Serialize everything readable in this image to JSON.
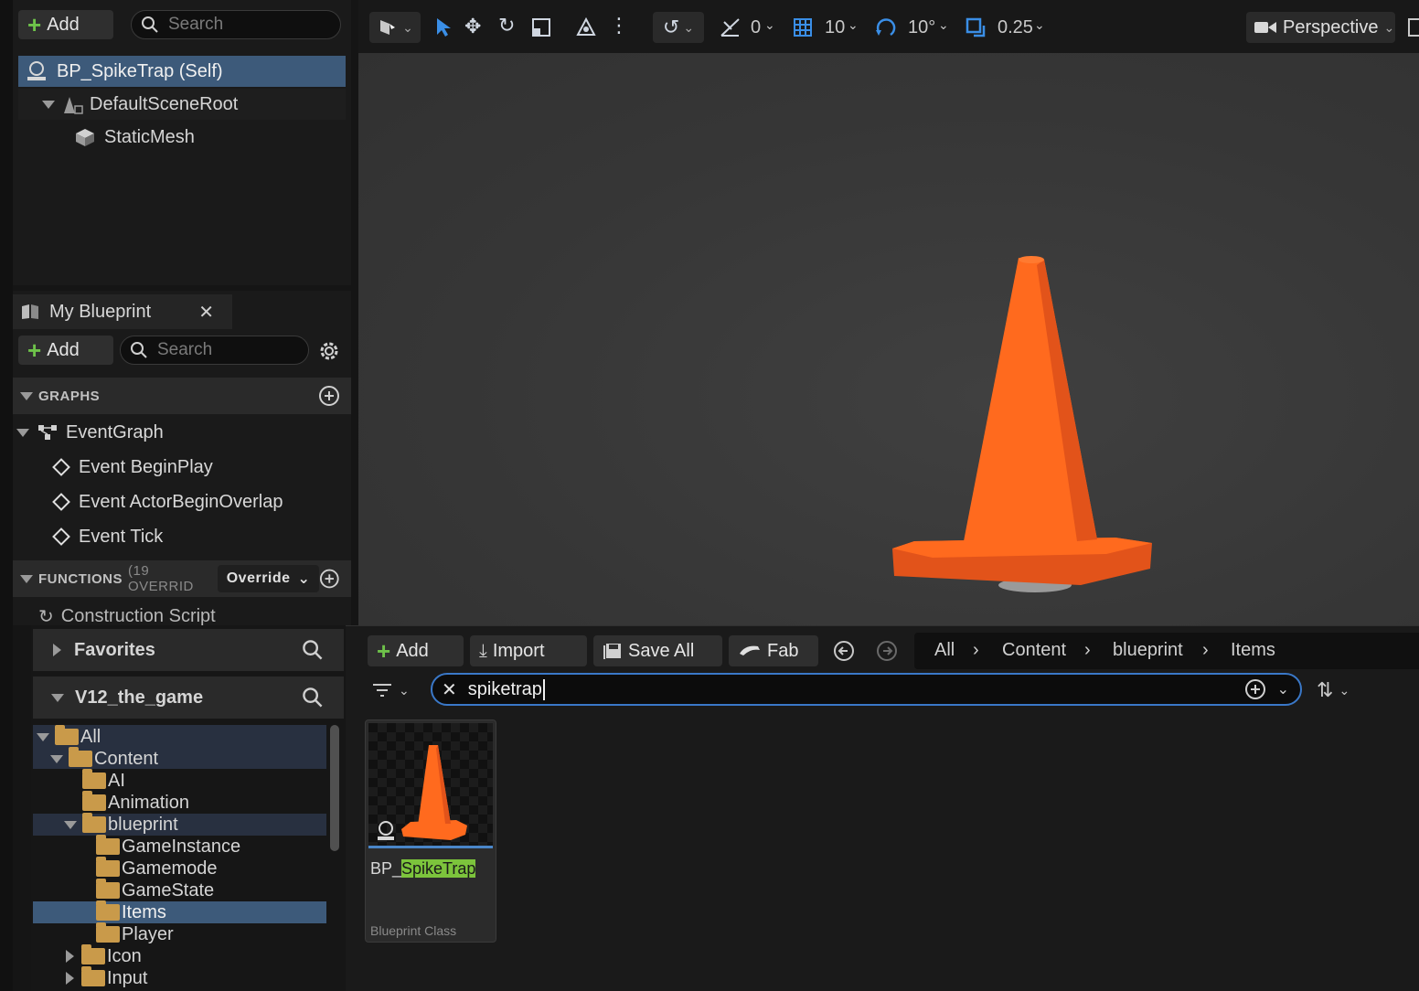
{
  "components": {
    "add_label": "Add",
    "search_placeholder": "Search",
    "items": [
      {
        "label": "BP_SpikeTrap (Self)"
      },
      {
        "label": "DefaultSceneRoot"
      },
      {
        "label": "StaticMesh"
      }
    ]
  },
  "my_blueprint": {
    "tab_label": "My Blueprint",
    "add_label": "Add",
    "search_placeholder": "Search",
    "graphs_header": "GRAPHS",
    "event_graph": "EventGraph",
    "events": [
      "Event BeginPlay",
      "Event ActorBeginOverlap",
      "Event Tick"
    ],
    "functions_header": "FUNCTIONS",
    "functions_count": "(19 OVERRID",
    "override_label": "Override",
    "construction_script": "Construction Script"
  },
  "viewport_toolbar": {
    "rotation_snap": "0",
    "grid_snap": "10",
    "angle_snap": "10°",
    "scale_snap": "0.25",
    "view_mode": "Perspective"
  },
  "content_sidebar": {
    "favorites": "Favorites",
    "project": "V12_the_game",
    "tree": [
      {
        "label": "All"
      },
      {
        "label": "Content"
      },
      {
        "label": "AI"
      },
      {
        "label": "Animation"
      },
      {
        "label": "blueprint"
      },
      {
        "label": "GameInstance"
      },
      {
        "label": "Gamemode"
      },
      {
        "label": "GameState"
      },
      {
        "label": "Items"
      },
      {
        "label": "Player"
      },
      {
        "label": "Icon"
      },
      {
        "label": "Input"
      }
    ]
  },
  "content_toolbar": {
    "add": "Add",
    "import": "Import",
    "save_all": "Save All",
    "fab": "Fab",
    "breadcrumbs": [
      "All",
      "Content",
      "blueprint",
      "Items"
    ]
  },
  "filter": {
    "search_value": "spiketrap"
  },
  "asset": {
    "name_prefix": "BP_",
    "name_highlight": "SpikeTrap",
    "type": "Blueprint Class"
  },
  "colors": {
    "accent": "#4a86c8",
    "cone_orange": "#ff6a1e",
    "highlight_green": "#7cc43c",
    "selected_row": "#3d5a7a"
  }
}
